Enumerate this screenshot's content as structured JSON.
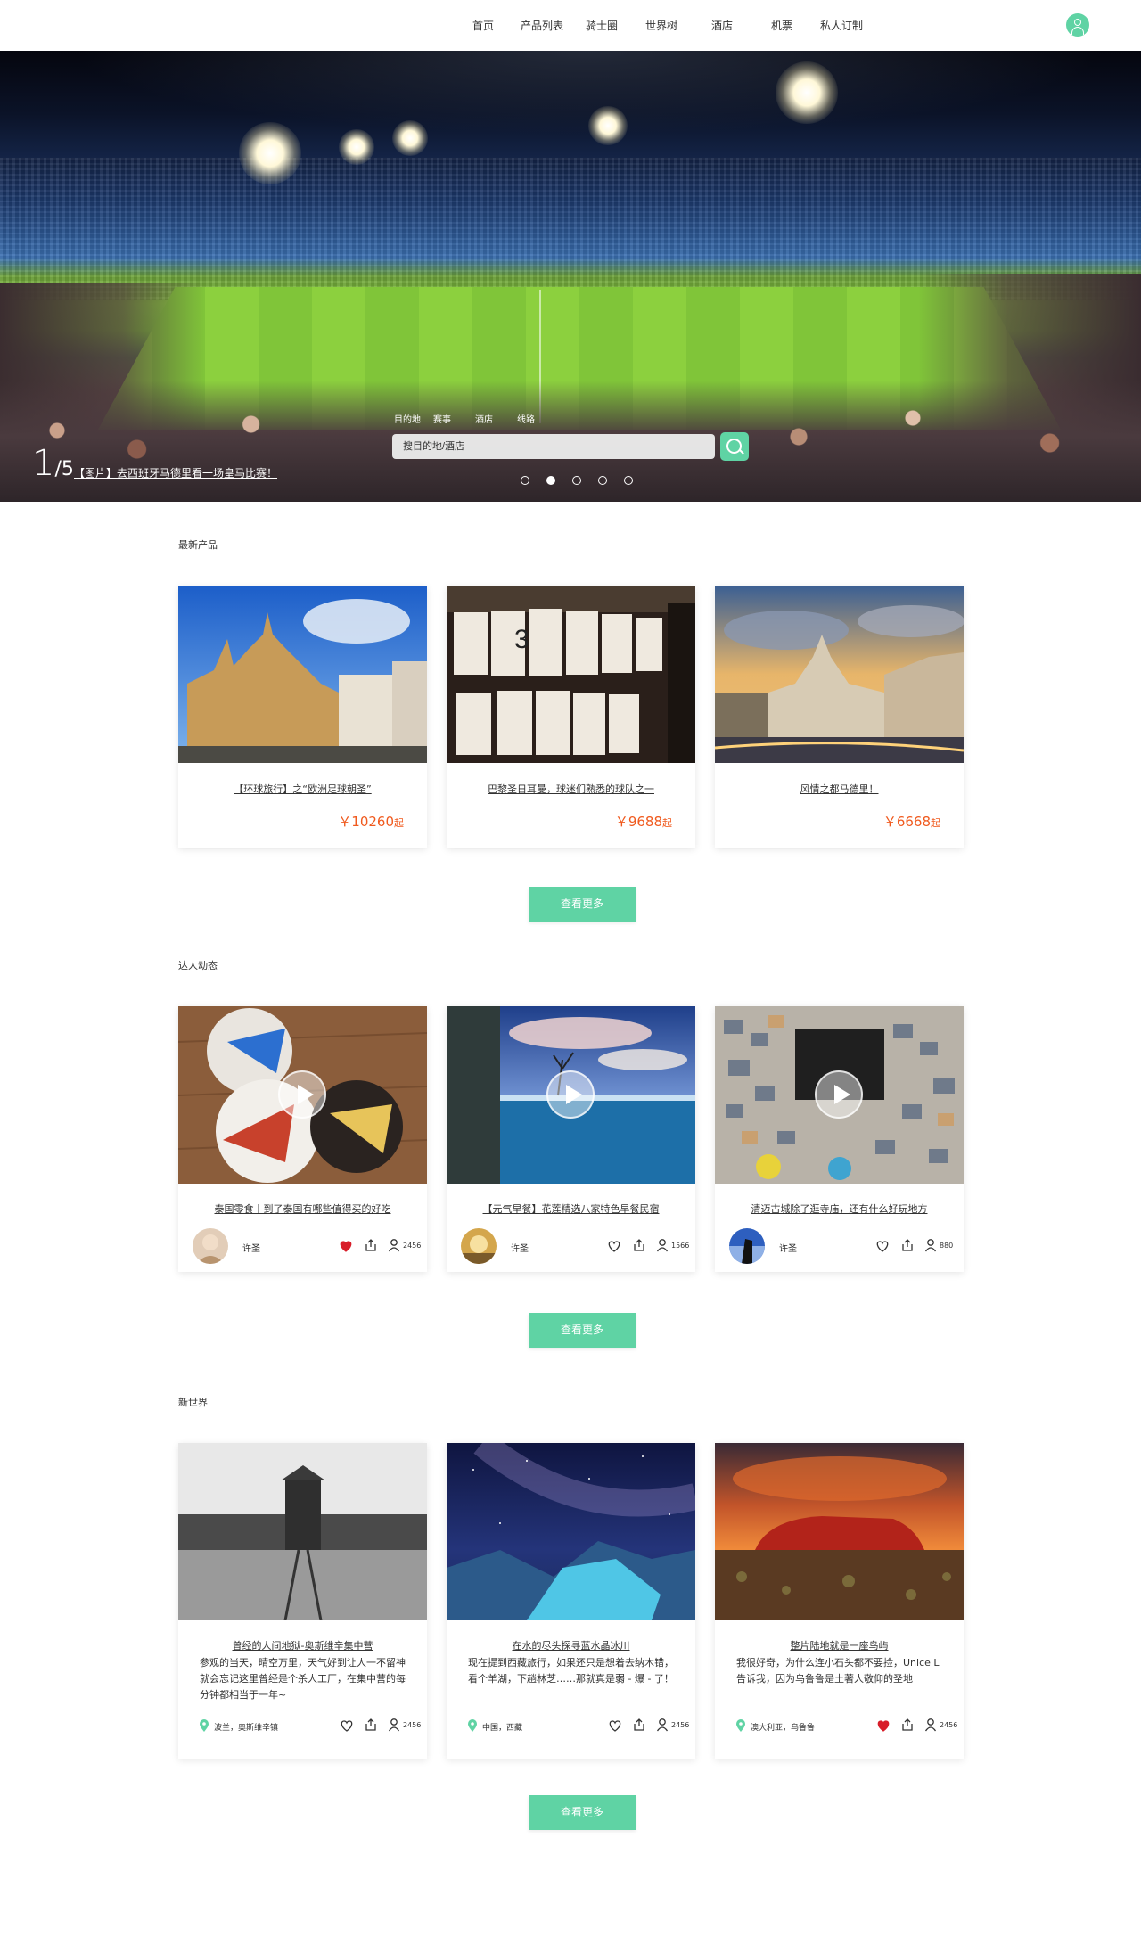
{
  "nav": {
    "items": [
      "首页",
      "产品列表",
      "骑士圈",
      "世界树",
      "酒店",
      "机票",
      "私人订制"
    ]
  },
  "hero": {
    "counter_current": "1",
    "counter_total": "/5",
    "caption": "【图片】去西班牙马德里看一场皇马比赛！",
    "search_tabs": [
      "目的地",
      "赛事",
      "酒店",
      "线路"
    ],
    "search_placeholder": "搜目的地/酒店",
    "slide_count": 5,
    "active_slide": 2
  },
  "sections": {
    "products_title": "最新产品",
    "experts_title": "达人动态",
    "world_title": "新世界",
    "more_label": "查看更多"
  },
  "products": [
    {
      "title": "【环球旅行】之“欧洲足球朝圣”",
      "price": "￥10260",
      "suffix": "起"
    },
    {
      "title": "巴黎圣日耳曼，球迷们熟悉的球队之一",
      "price": "￥9688",
      "suffix": "起"
    },
    {
      "title": "风情之都马德里！",
      "price": "￥6668",
      "suffix": "起"
    }
  ],
  "experts": [
    {
      "title": "泰国零食丨到了泰国有哪些值得买的好吃",
      "author": "许圣",
      "liked": true,
      "count": "2456"
    },
    {
      "title": "【元气早餐】花莲精选八家特色早餐民宿",
      "author": "许圣",
      "liked": false,
      "count": "1566"
    },
    {
      "title": "清迈古城除了逛寺庙，还有什么好玩地方",
      "author": "许圣",
      "liked": false,
      "count": "880"
    }
  ],
  "world": [
    {
      "title": "曾经的人间地狱-奥斯维辛集中营",
      "desc": "参观的当天，晴空万里，天气好到让人一不留神就会忘记这里曾经是个杀人工厂，在集中营的每分钟都相当于一年~",
      "location": "波兰，奥斯维辛镇",
      "liked": false,
      "count": "2456"
    },
    {
      "title": "在水的尽头探寻蓝水晶冰川",
      "desc": "现在提到西藏旅行，如果还只是想着去纳木错，看个羊湖，下趟林芝……那就真是弱 - 爆 - 了！",
      "location": "中国，西藏",
      "liked": false,
      "count": "2456"
    },
    {
      "title": "整片陆地就是一座鸟屿",
      "desc": "我很好奇，为什么连小石头都不要捡，Unice L告诉我，因为乌鲁鲁是土著人敬仰的圣地",
      "location": "澳大利亚，乌鲁鲁",
      "liked": true,
      "count": "2456"
    }
  ],
  "colors": {
    "accent": "#5fd3a4",
    "price": "#f05a1e",
    "liked_heart": "#d81e2a"
  }
}
